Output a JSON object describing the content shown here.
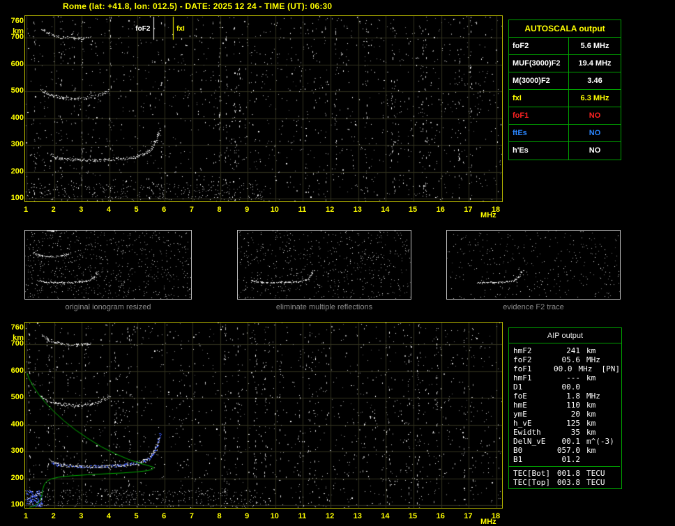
{
  "title": "Rome (lat: +41.8, lon: 012.5) - DATE: 2025 12 24 - TIME (UT): 06:30",
  "autoscala_table": {
    "header": "AUTOSCALA output",
    "rows": [
      {
        "label": "foF2",
        "value": "5.6 MHz",
        "color": "#ffffff"
      },
      {
        "label": "MUF(3000)F2",
        "value": "19.4 MHz",
        "color": "#ffffff"
      },
      {
        "label": "M(3000)F2",
        "value": "3.46",
        "color": "#ffffff"
      },
      {
        "label": "fxI",
        "value": "6.3 MHz",
        "color": "#ffff00"
      },
      {
        "label": "foF1",
        "value": "NO",
        "color": "#ff2222"
      },
      {
        "label": "ftEs",
        "value": "NO",
        "color": "#2a86ff"
      },
      {
        "label": "h'Es",
        "value": "NO",
        "color": "#ffffff"
      }
    ]
  },
  "thumbnails": [
    {
      "caption": "original ionogram resized"
    },
    {
      "caption": "eliminate multiple reflections"
    },
    {
      "caption": "evidence F2 trace"
    }
  ],
  "aip_table": {
    "header": "AIP output",
    "rows": [
      {
        "name": "hmF2",
        "value": "241",
        "unit": "km",
        "extra": ""
      },
      {
        "name": "foF2",
        "value": "05.6",
        "unit": "MHz",
        "extra": ""
      },
      {
        "name": "foF1",
        "value": "00.0",
        "unit": "MHz",
        "extra": "[PN]"
      },
      {
        "name": "hmF1",
        "value": "---",
        "unit": "km",
        "extra": ""
      },
      {
        "name": "D1",
        "value": "00.0",
        "unit": "",
        "extra": ""
      },
      {
        "name": "foE",
        "value": "1.8",
        "unit": "MHz",
        "extra": ""
      },
      {
        "name": "hmE",
        "value": "110",
        "unit": "km",
        "extra": ""
      },
      {
        "name": "ymE",
        "value": "20",
        "unit": "km",
        "extra": ""
      },
      {
        "name": "h_vE",
        "value": "125",
        "unit": "km",
        "extra": ""
      },
      {
        "name": "Ewidth",
        "value": "35",
        "unit": "km",
        "extra": ""
      },
      {
        "name": "DelN_vE",
        "value": "00.1",
        "unit": "m^(-3)",
        "extra": ""
      },
      {
        "name": "B0",
        "value": "057.0",
        "unit": "km",
        "extra": ""
      },
      {
        "name": "B1",
        "value": "01.2",
        "unit": "",
        "extra": ""
      }
    ],
    "tec_rows": [
      {
        "name": "TEC[Bot]",
        "value": "001.8",
        "unit": "TECU",
        "extra": ""
      },
      {
        "name": "TEC[Top]",
        "value": "003.8",
        "unit": "TECU",
        "extra": ""
      }
    ]
  },
  "chart_data": {
    "type": "scatter",
    "title": "Ionogram (virtual height vs sounding frequency) with AUTOSCALA scaling",
    "x_axis": {
      "label": "MHz",
      "min": 1,
      "max": 18,
      "ticks": [
        1,
        2,
        3,
        4,
        5,
        6,
        7,
        8,
        9,
        10,
        11,
        12,
        13,
        14,
        15,
        16,
        17,
        18
      ]
    },
    "y_axis": {
      "label": "km",
      "min": 100,
      "max": 780,
      "ticks": [
        760,
        700,
        600,
        500,
        400,
        300,
        200,
        100
      ]
    },
    "annotations": [
      {
        "label": "foF2",
        "freq_mhz": 5.6,
        "color": "#ffffff",
        "side": "left"
      },
      {
        "label": "fxI",
        "freq_mhz": 6.3,
        "color": "#ffff00",
        "side": "right"
      }
    ],
    "scaled_values": {
      "foF2_MHz": 5.6,
      "MUF3000F2_MHz": 19.4,
      "M3000F2": 3.46,
      "fxI_MHz": 6.3,
      "hmF2_km": 241,
      "foE_MHz": 1.8,
      "hmE_km": 110,
      "B0_km": 57.0,
      "B1": 1.2,
      "TEC_bot_TECU": 1.8,
      "TEC_top_TECU": 3.8
    },
    "traces": {
      "f2_trace": [
        [
          1.85,
          268
        ],
        [
          2.0,
          258
        ],
        [
          2.2,
          252
        ],
        [
          2.5,
          248
        ],
        [
          2.9,
          245
        ],
        [
          3.3,
          244
        ],
        [
          3.7,
          245
        ],
        [
          4.1,
          247
        ],
        [
          4.5,
          250
        ],
        [
          4.9,
          255
        ],
        [
          5.15,
          262
        ],
        [
          5.35,
          272
        ],
        [
          5.5,
          286
        ],
        [
          5.62,
          305
        ],
        [
          5.72,
          330
        ],
        [
          5.8,
          355
        ]
      ],
      "multiple_reflection_trace": [
        [
          1.5,
          508
        ],
        [
          1.65,
          496
        ],
        [
          1.85,
          487
        ],
        [
          2.1,
          480
        ],
        [
          2.4,
          475
        ],
        [
          2.7,
          473
        ],
        [
          3.0,
          474
        ],
        [
          3.3,
          478
        ],
        [
          3.6,
          486
        ],
        [
          3.85,
          497
        ],
        [
          4.0,
          510
        ]
      ],
      "third_reflection_trace": [
        [
          1.55,
          735
        ],
        [
          1.7,
          722
        ],
        [
          1.9,
          712
        ],
        [
          2.15,
          705
        ],
        [
          2.45,
          700
        ],
        [
          2.75,
          698
        ],
        [
          3.05,
          700
        ],
        [
          3.3,
          705
        ]
      ],
      "restored_trace_blue": [
        [
          1.9,
          255
        ],
        [
          2.2,
          250
        ],
        [
          2.6,
          246
        ],
        [
          3.0,
          244
        ],
        [
          3.5,
          244
        ],
        [
          4.0,
          246
        ],
        [
          4.5,
          250
        ],
        [
          4.9,
          256
        ],
        [
          5.2,
          264
        ],
        [
          5.45,
          277
        ],
        [
          5.6,
          296
        ],
        [
          5.7,
          320
        ],
        [
          5.78,
          348
        ],
        [
          5.84,
          372
        ]
      ],
      "electron_density_profile_green": [
        [
          1.02,
          592
        ],
        [
          1.1,
          570
        ],
        [
          1.25,
          542
        ],
        [
          1.45,
          512
        ],
        [
          1.7,
          480
        ],
        [
          2.0,
          448
        ],
        [
          2.35,
          415
        ],
        [
          2.75,
          382
        ],
        [
          3.2,
          350
        ],
        [
          3.7,
          318
        ],
        [
          4.2,
          292
        ],
        [
          4.7,
          270
        ],
        [
          5.1,
          256
        ],
        [
          5.45,
          246
        ],
        [
          5.6,
          241
        ],
        [
          5.55,
          233
        ],
        [
          5.35,
          228
        ],
        [
          5.0,
          224
        ],
        [
          4.5,
          220
        ],
        [
          3.9,
          217
        ],
        [
          3.2,
          213
        ],
        [
          2.6,
          209
        ],
        [
          2.15,
          204
        ],
        [
          1.9,
          198
        ],
        [
          1.75,
          190
        ],
        [
          1.65,
          178
        ],
        [
          1.6,
          163
        ],
        [
          1.57,
          148
        ],
        [
          1.55,
          135
        ],
        [
          1.52,
          126
        ],
        [
          1.5,
          120
        ],
        [
          1.45,
          112
        ],
        [
          1.4,
          106
        ],
        [
          1.35,
          100
        ],
        [
          1.28,
          96
        ],
        [
          1.2,
          94
        ],
        [
          1.1,
          92
        ]
      ]
    }
  }
}
